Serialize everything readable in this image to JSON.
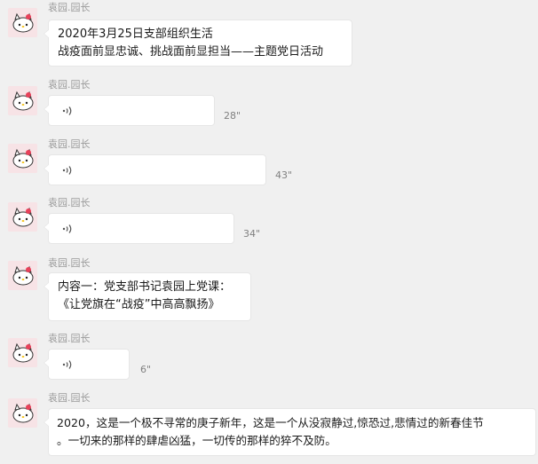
{
  "sender_name": "袁园.园长",
  "messages": [
    {
      "type": "text",
      "lines": [
        "2020年3月25日支部组织生活",
        "战疫面前显忠诚、挑战面前显担当——主题党日活动"
      ]
    },
    {
      "type": "voice",
      "duration": "28\""
    },
    {
      "type": "voice",
      "duration": "43\""
    },
    {
      "type": "voice",
      "duration": "34\""
    },
    {
      "type": "text",
      "lines": [
        "内容一：党支部书记袁园上党课：",
        "《让党旗在“战疫”中高高飘扬》"
      ]
    },
    {
      "type": "voice",
      "duration": "6\""
    },
    {
      "type": "text",
      "lines": [
        "2020，这是一个极不寻常的庚子新年，这是一个从没寂静过,惊恐过,悲情过的新春佳节",
        "。一切来的那样的肆虐凶猛，一切传的那样的猝不及防。"
      ]
    }
  ],
  "icons": {
    "avatar": "hello-kitty-avatar-icon",
    "voice": "voice-wave-icon"
  }
}
